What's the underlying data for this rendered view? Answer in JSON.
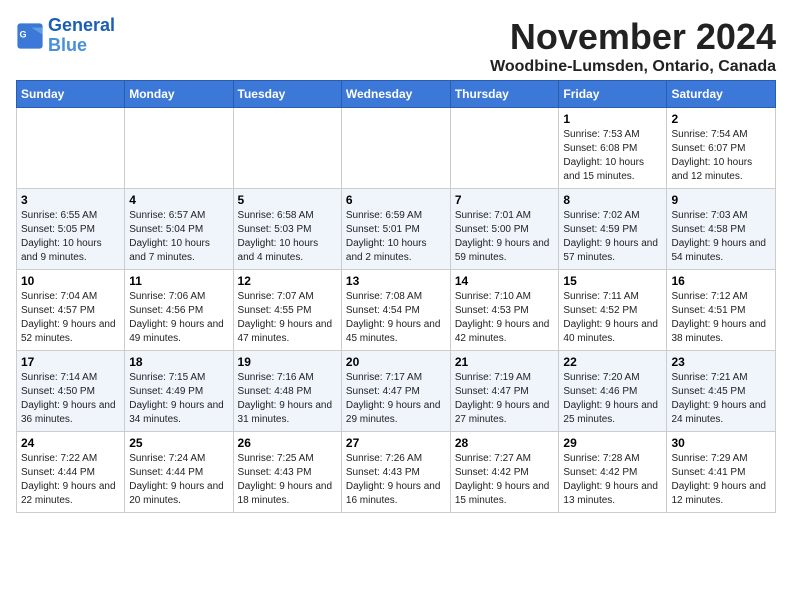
{
  "header": {
    "logo_line1": "General",
    "logo_line2": "Blue",
    "month": "November 2024",
    "location": "Woodbine-Lumsden, Ontario, Canada"
  },
  "weekdays": [
    "Sunday",
    "Monday",
    "Tuesday",
    "Wednesday",
    "Thursday",
    "Friday",
    "Saturday"
  ],
  "weeks": [
    [
      {
        "day": "",
        "info": ""
      },
      {
        "day": "",
        "info": ""
      },
      {
        "day": "",
        "info": ""
      },
      {
        "day": "",
        "info": ""
      },
      {
        "day": "",
        "info": ""
      },
      {
        "day": "1",
        "info": "Sunrise: 7:53 AM\nSunset: 6:08 PM\nDaylight: 10 hours and 15 minutes."
      },
      {
        "day": "2",
        "info": "Sunrise: 7:54 AM\nSunset: 6:07 PM\nDaylight: 10 hours and 12 minutes."
      }
    ],
    [
      {
        "day": "3",
        "info": "Sunrise: 6:55 AM\nSunset: 5:05 PM\nDaylight: 10 hours and 9 minutes."
      },
      {
        "day": "4",
        "info": "Sunrise: 6:57 AM\nSunset: 5:04 PM\nDaylight: 10 hours and 7 minutes."
      },
      {
        "day": "5",
        "info": "Sunrise: 6:58 AM\nSunset: 5:03 PM\nDaylight: 10 hours and 4 minutes."
      },
      {
        "day": "6",
        "info": "Sunrise: 6:59 AM\nSunset: 5:01 PM\nDaylight: 10 hours and 2 minutes."
      },
      {
        "day": "7",
        "info": "Sunrise: 7:01 AM\nSunset: 5:00 PM\nDaylight: 9 hours and 59 minutes."
      },
      {
        "day": "8",
        "info": "Sunrise: 7:02 AM\nSunset: 4:59 PM\nDaylight: 9 hours and 57 minutes."
      },
      {
        "day": "9",
        "info": "Sunrise: 7:03 AM\nSunset: 4:58 PM\nDaylight: 9 hours and 54 minutes."
      }
    ],
    [
      {
        "day": "10",
        "info": "Sunrise: 7:04 AM\nSunset: 4:57 PM\nDaylight: 9 hours and 52 minutes."
      },
      {
        "day": "11",
        "info": "Sunrise: 7:06 AM\nSunset: 4:56 PM\nDaylight: 9 hours and 49 minutes."
      },
      {
        "day": "12",
        "info": "Sunrise: 7:07 AM\nSunset: 4:55 PM\nDaylight: 9 hours and 47 minutes."
      },
      {
        "day": "13",
        "info": "Sunrise: 7:08 AM\nSunset: 4:54 PM\nDaylight: 9 hours and 45 minutes."
      },
      {
        "day": "14",
        "info": "Sunrise: 7:10 AM\nSunset: 4:53 PM\nDaylight: 9 hours and 42 minutes."
      },
      {
        "day": "15",
        "info": "Sunrise: 7:11 AM\nSunset: 4:52 PM\nDaylight: 9 hours and 40 minutes."
      },
      {
        "day": "16",
        "info": "Sunrise: 7:12 AM\nSunset: 4:51 PM\nDaylight: 9 hours and 38 minutes."
      }
    ],
    [
      {
        "day": "17",
        "info": "Sunrise: 7:14 AM\nSunset: 4:50 PM\nDaylight: 9 hours and 36 minutes."
      },
      {
        "day": "18",
        "info": "Sunrise: 7:15 AM\nSunset: 4:49 PM\nDaylight: 9 hours and 34 minutes."
      },
      {
        "day": "19",
        "info": "Sunrise: 7:16 AM\nSunset: 4:48 PM\nDaylight: 9 hours and 31 minutes."
      },
      {
        "day": "20",
        "info": "Sunrise: 7:17 AM\nSunset: 4:47 PM\nDaylight: 9 hours and 29 minutes."
      },
      {
        "day": "21",
        "info": "Sunrise: 7:19 AM\nSunset: 4:47 PM\nDaylight: 9 hours and 27 minutes."
      },
      {
        "day": "22",
        "info": "Sunrise: 7:20 AM\nSunset: 4:46 PM\nDaylight: 9 hours and 25 minutes."
      },
      {
        "day": "23",
        "info": "Sunrise: 7:21 AM\nSunset: 4:45 PM\nDaylight: 9 hours and 24 minutes."
      }
    ],
    [
      {
        "day": "24",
        "info": "Sunrise: 7:22 AM\nSunset: 4:44 PM\nDaylight: 9 hours and 22 minutes."
      },
      {
        "day": "25",
        "info": "Sunrise: 7:24 AM\nSunset: 4:44 PM\nDaylight: 9 hours and 20 minutes."
      },
      {
        "day": "26",
        "info": "Sunrise: 7:25 AM\nSunset: 4:43 PM\nDaylight: 9 hours and 18 minutes."
      },
      {
        "day": "27",
        "info": "Sunrise: 7:26 AM\nSunset: 4:43 PM\nDaylight: 9 hours and 16 minutes."
      },
      {
        "day": "28",
        "info": "Sunrise: 7:27 AM\nSunset: 4:42 PM\nDaylight: 9 hours and 15 minutes."
      },
      {
        "day": "29",
        "info": "Sunrise: 7:28 AM\nSunset: 4:42 PM\nDaylight: 9 hours and 13 minutes."
      },
      {
        "day": "30",
        "info": "Sunrise: 7:29 AM\nSunset: 4:41 PM\nDaylight: 9 hours and 12 minutes."
      }
    ]
  ]
}
